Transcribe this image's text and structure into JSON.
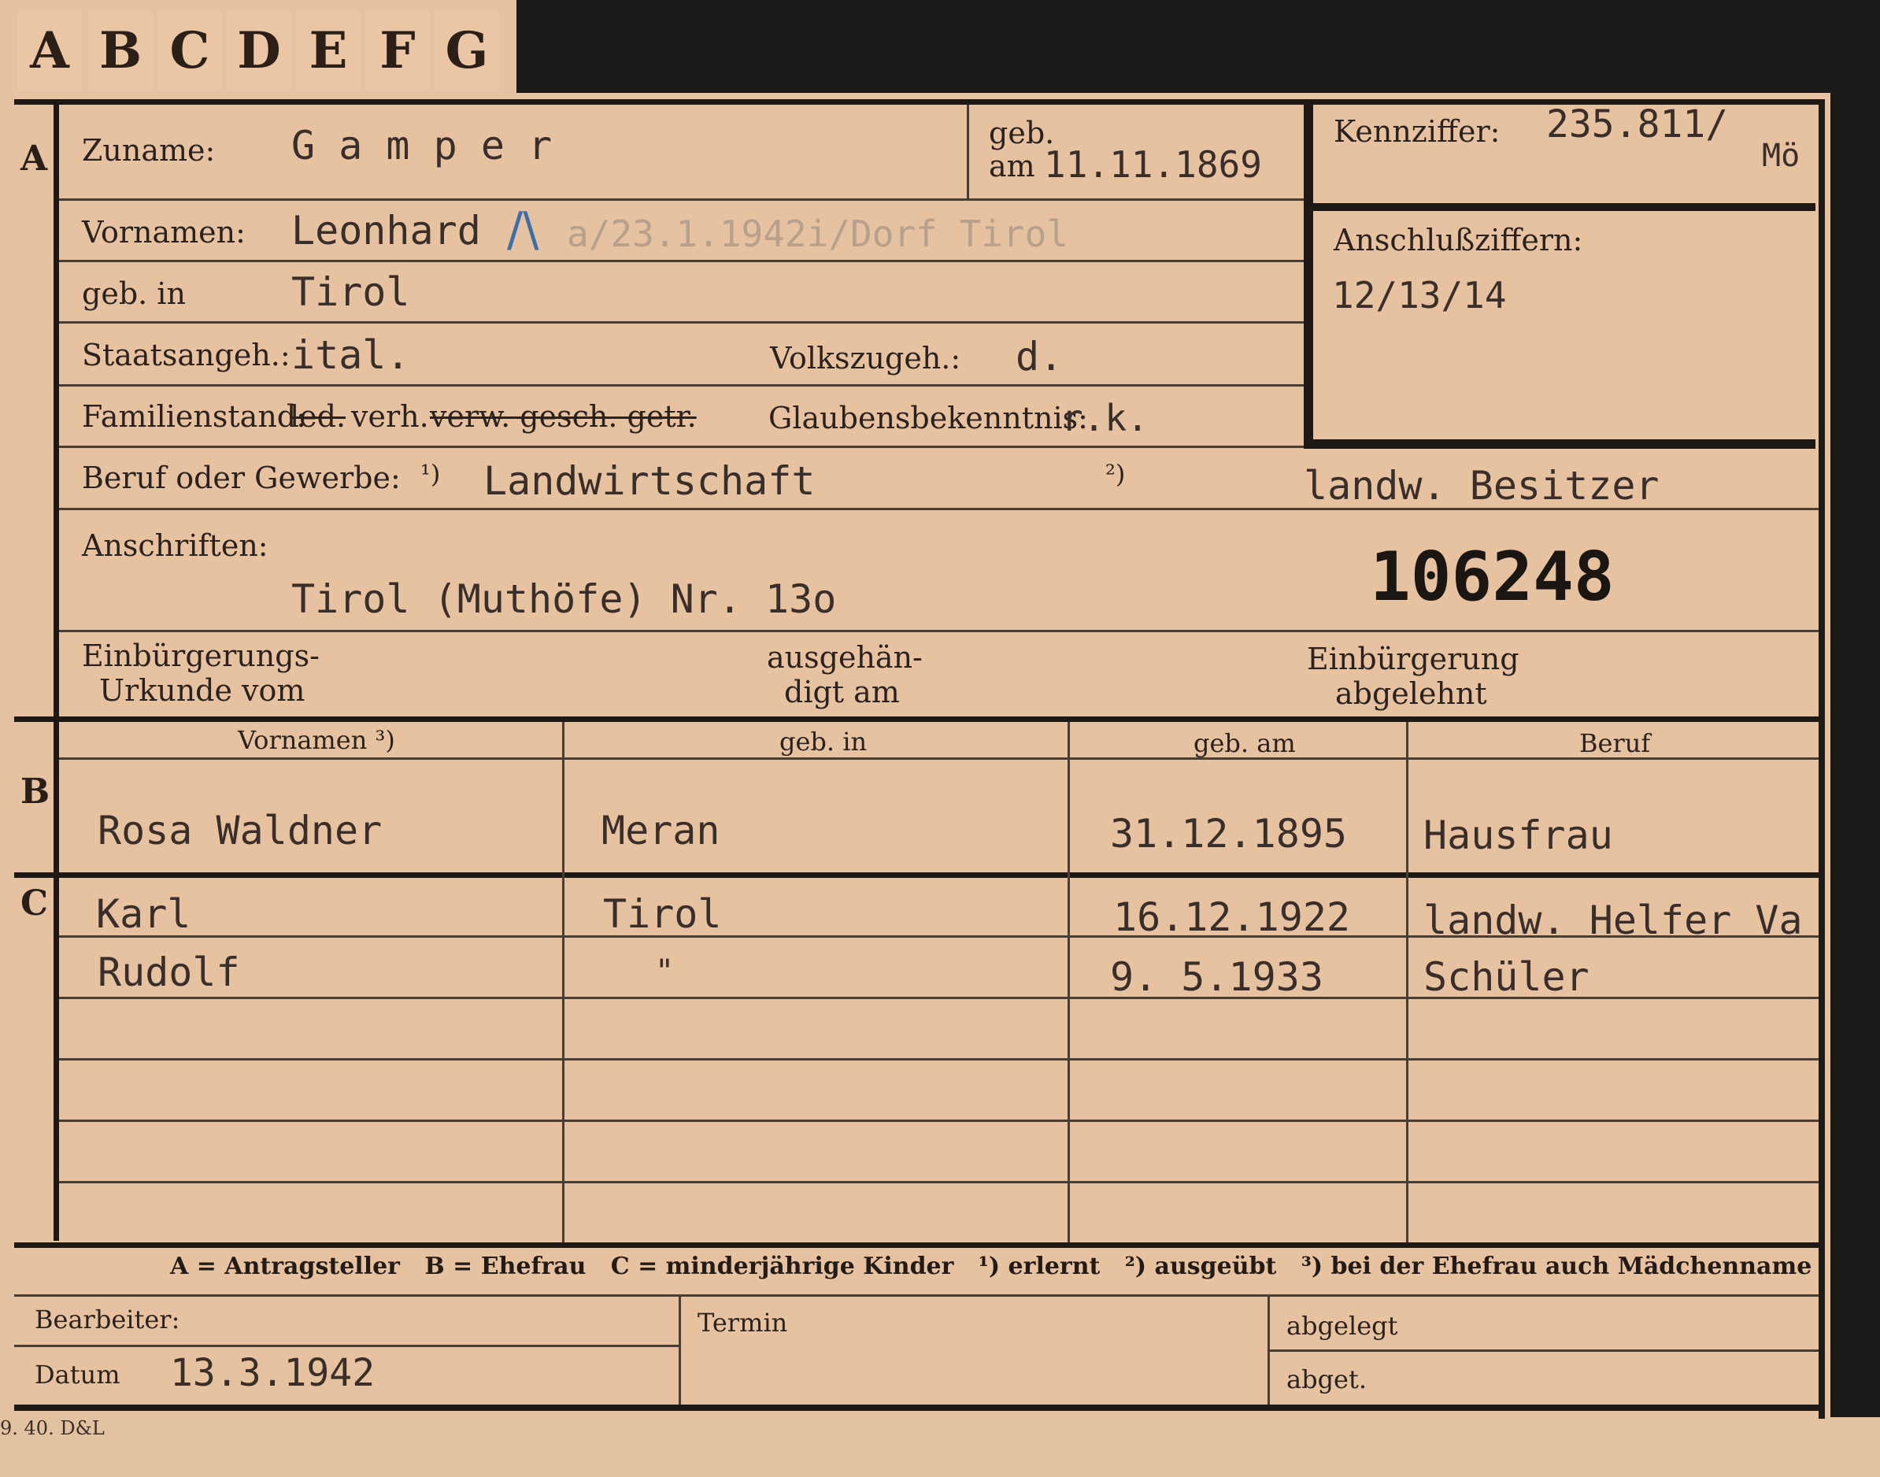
{
  "tabs": [
    "A",
    "B",
    "C",
    "D",
    "E",
    "F",
    "G"
  ],
  "section_letters": {
    "a": "A",
    "b": "B",
    "c": "C"
  },
  "header": {
    "zuname_label": "Zuname:",
    "zuname_value": "G a m p e r",
    "geb_label": "geb.",
    "geb_am_label": "am",
    "geb_date": "11.11.1869",
    "kennziffer_label": "Kennziffer:",
    "kennziffer_value": "235.811/",
    "kennziffer_suffix": "Mö",
    "anschluss_label": "Anschlußziffern:",
    "anschluss_value": "12/13/14"
  },
  "person": {
    "vornamen_label": "Vornamen:",
    "vornamen_value": "Leonhard",
    "vornamen_mark": "/\\",
    "vornamen_note": "a/23.1.1942i/Dorf Tirol",
    "geb_in_label": "geb. in",
    "geb_in_value": "Tirol",
    "staatsangeh_label": "Staatsangeh.:",
    "staatsangeh_value": "ital.",
    "volkszugeh_label": "Volkszugeh.:",
    "volkszugeh_value": "d.",
    "familienstand_label": "Familienstand:",
    "familienstand_struck_1": "led.",
    "familienstand_value": "verh.",
    "familienstand_struck_2": "verw. gesch. getr.",
    "glaubens_label": "Glaubensbekenntnis:",
    "glaubens_value": "r.k.",
    "beruf_label": "Beruf oder Gewerbe:",
    "beruf_note1": "¹)",
    "beruf_value1": "Landwirtschaft",
    "beruf_note2": "²)",
    "beruf_value2": "landw. Besitzer",
    "anschriften_label": "Anschriften:",
    "anschriften_value": "Tirol (Muthöfe) Nr. 13o",
    "number": "106248",
    "einb_label_1": "Einbürgerungs-",
    "einb_label_2": "Urkunde vom",
    "ausg_label_1": "ausgehän-",
    "ausg_label_2": "digt am",
    "abgelehnt_label_1": "Einbürgerung",
    "abgelehnt_label_2": "abgelehnt"
  },
  "columns": {
    "vornamen": "Vornamen ³)",
    "geb_in": "geb. in",
    "geb_am": "geb. am",
    "beruf": "Beruf"
  },
  "spouse": {
    "vornamen": "Rosa Waldner",
    "geb_in": "Meran",
    "geb_am": "31.12.1895",
    "beruf": "Hausfrau"
  },
  "children": [
    {
      "vornamen": "Karl",
      "geb_in": "Tirol",
      "geb_am": "16.12.1922",
      "beruf": "landw. Helfer Va"
    },
    {
      "vornamen": "Rudolf",
      "geb_in": "\"",
      "geb_am": "9. 5.1933",
      "beruf": "Schüler"
    }
  ],
  "legend": "A = Antragsteller   B = Ehefrau   C = minderjährige Kinder   ¹) erlernt   ²) ausgeübt   ³) bei der Ehefrau auch Mädchenname",
  "footer": {
    "bearbeiter_label": "Bearbeiter:",
    "datum_label": "Datum",
    "datum_value": "13.3.1942",
    "termin_label": "Termin",
    "abgelegt_label": "abgelegt",
    "abgelegt2_label": "abget."
  },
  "print_code": "9. 40. D&L"
}
